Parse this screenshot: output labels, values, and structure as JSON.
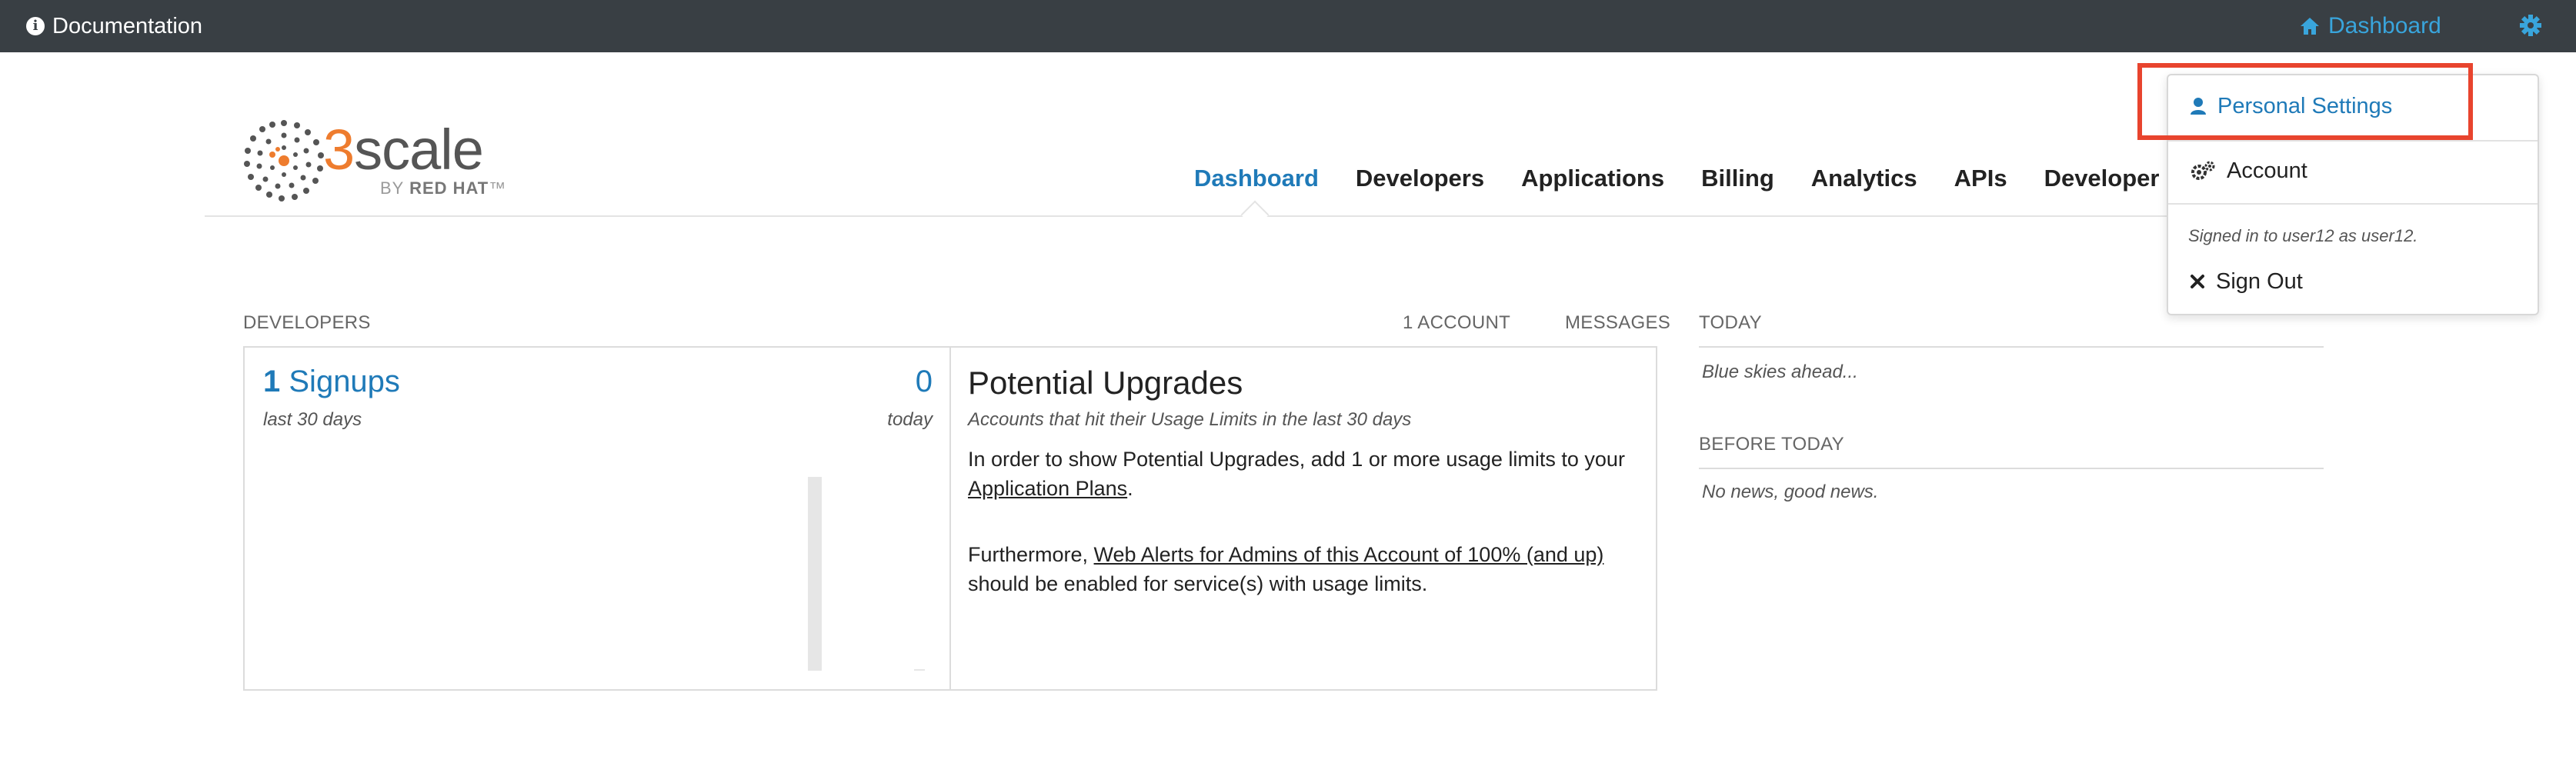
{
  "topbar": {
    "documentation_label": "Documentation",
    "dashboard_label": "Dashboard"
  },
  "logo": {
    "brand_prefix": "3",
    "brand_rest": "scale",
    "by": "BY",
    "company": "RED HAT",
    "trademark": "™"
  },
  "nav": {
    "items": [
      {
        "label": "Dashboard",
        "active": true
      },
      {
        "label": "Developers",
        "active": false
      },
      {
        "label": "Applications",
        "active": false
      },
      {
        "label": "Billing",
        "active": false
      },
      {
        "label": "Analytics",
        "active": false
      },
      {
        "label": "APIs",
        "active": false
      },
      {
        "label": "Developer Po",
        "active": false
      }
    ]
  },
  "developers": {
    "header": "DEVELOPERS",
    "account_link": "1 ACCOUNT",
    "messages_link": "MESSAGES",
    "signups_number": "1",
    "signups_label": "Signups",
    "signups_period": "last 30 days",
    "today_count": "0",
    "today_label": "today"
  },
  "potential_upgrades": {
    "title": "Potential Upgrades",
    "subtitle": "Accounts that hit their Usage Limits in the last 30 days",
    "p1_before": "In order to show Potential Upgrades, add 1 or more usage limits to your ",
    "p1_link": "Application Plans",
    "p1_after": ".",
    "p2_before": "Furthermore, ",
    "p2_link": "Web Alerts for Admins of this Account of 100% (and up)",
    "p2_after": " should be enabled for service(s) with usage limits."
  },
  "news": {
    "today_header": "TODAY",
    "today_text": "Blue skies ahead...",
    "before_header": "BEFORE TODAY",
    "before_text": "No news, good news."
  },
  "dropdown": {
    "personal_settings": "Personal Settings",
    "account": "Account",
    "signed_in": "Signed in to user12 as user12.",
    "sign_out": "Sign Out"
  },
  "colors": {
    "topbar_bg": "#393f44",
    "link_blue": "#1f7ab8",
    "topbar_link": "#39a5dc",
    "brand_orange": "#ee7c2e",
    "highlight_red": "#e8442e"
  }
}
